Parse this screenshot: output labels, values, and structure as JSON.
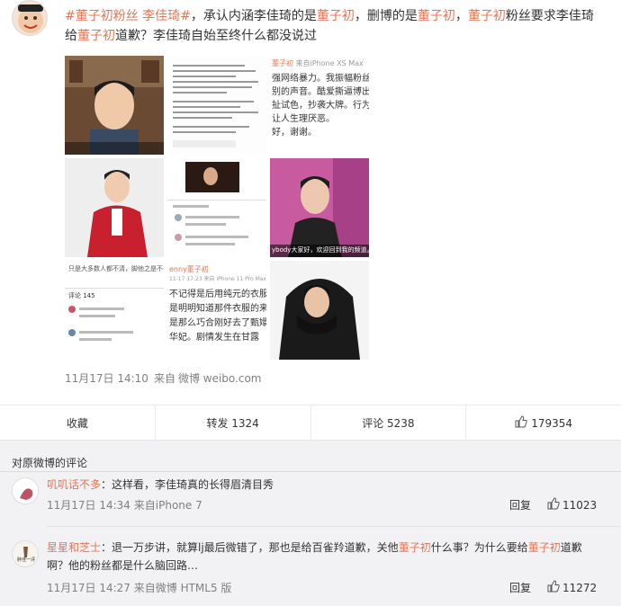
{
  "post": {
    "text_parts": [
      {
        "t": "#董子初粉丝 李佳琦#",
        "hl": true
      },
      {
        "t": "，承认内涵李佳琦的是",
        "hl": false
      },
      {
        "t": "董子初",
        "hl": true
      },
      {
        "t": "，删博的是",
        "hl": false
      },
      {
        "t": "董子初",
        "hl": true
      },
      {
        "t": "，",
        "hl": false
      },
      {
        "t": "董子初",
        "hl": true
      },
      {
        "t": "粉丝要求李佳琦给",
        "hl": false
      },
      {
        "t": "董子初",
        "hl": true
      },
      {
        "t": "道歉？李佳琦自始至终什么都没说过",
        "hl": false
      }
    ],
    "images": {
      "img2_title": "董子初",
      "img2_device": "来自iPhone XS Max",
      "img2_line1": "强网络暴力。我振幅粉丝",
      "img2_line2": "别的声音。酷爱撕逼博出",
      "img2_line3": "扯试色，抄袭大牌。行为半",
      "img2_line4": "让人生理厌恶。",
      "img2_line5": "好，谢谢。",
      "img6_caption": "ybody大家好，欢迎回到我的频道。",
      "img7_text": "只是大多数人都不清，脚他之是不也清",
      "img7_cmt": "评论 145",
      "img8_title": "enny董子初",
      "img8_device": "11-17 17:23 来自 iPhone 11 Pro Max",
      "img8_line1": "不记得是后用纯元的衣服陷",
      "img8_line2": "是明明知道那件衣服的来历",
      "img8_line3": "是那么巧合刚好去了甄嬛那",
      "img8_line4": "华妃。剧情发生在甘露"
    },
    "timestamp": "11月17日 14:10",
    "source_prefix": "来自",
    "source": "微博 weibo.com"
  },
  "actions": {
    "favorite": "收藏",
    "repost": "转发 1324",
    "comment": "评论 5238",
    "like": "179354"
  },
  "comments_section": {
    "title": "对原微博的评论",
    "reply_label": "回复",
    "items": [
      {
        "user": "叽叽话不多",
        "text_parts": [
          {
            "t": "：这样看，李佳琦真的长得眉清目秀",
            "hl": false
          }
        ],
        "time": "11月17日 14:34",
        "source": "来自iPhone 7",
        "likes": "11023"
      },
      {
        "user": "星星和芝士",
        "avatar_text": "胖佳一评",
        "text_parts": [
          {
            "t": "：退一万步讲，就算lj最后微错了，那也是给百雀羚道歉，关他",
            "hl": false
          },
          {
            "t": "董子初",
            "hl": true
          },
          {
            "t": "什么事？为什么要给",
            "hl": false
          },
          {
            "t": "董子初",
            "hl": true
          },
          {
            "t": "道歉",
            "hl": false
          },
          {
            "t": "啊？他的粉丝都是什么脑回路…",
            "hl": false
          }
        ],
        "time": "11月17日 14:27",
        "source": "来自微博 HTML5 版",
        "likes": "11272"
      }
    ]
  }
}
